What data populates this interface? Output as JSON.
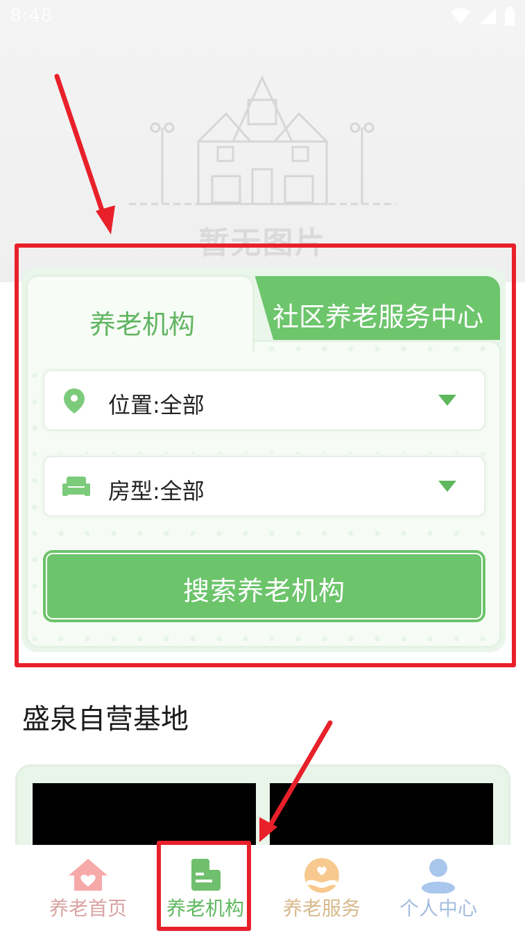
{
  "status_bar": {
    "time": "8:48"
  },
  "hero": {
    "placeholder_text": "暂无图片"
  },
  "search_card": {
    "tabs": [
      {
        "label": "养老机构",
        "active": true
      },
      {
        "label": "社区养老服务中心",
        "active": false
      }
    ],
    "location": {
      "label": "位置:",
      "value": "全部"
    },
    "room_type": {
      "label": "房型:",
      "value": "全部"
    },
    "search_button": "搜索养老机构"
  },
  "section": {
    "title": "盛泉自营基地"
  },
  "bottom_nav": {
    "items": [
      {
        "label": "养老首页",
        "icon": "home-heart-icon",
        "active": false
      },
      {
        "label": "养老机构",
        "icon": "building-icon",
        "active": true
      },
      {
        "label": "养老服务",
        "icon": "heart-hand-icon",
        "active": false
      },
      {
        "label": "个人中心",
        "icon": "person-icon",
        "active": false
      }
    ]
  },
  "colors": {
    "accent_green": "#6cc46b",
    "annotation_red": "#e8202a",
    "nav_home": "#f4a7a7",
    "nav_service": "#f5c98a",
    "nav_profile": "#a9c6ec"
  }
}
